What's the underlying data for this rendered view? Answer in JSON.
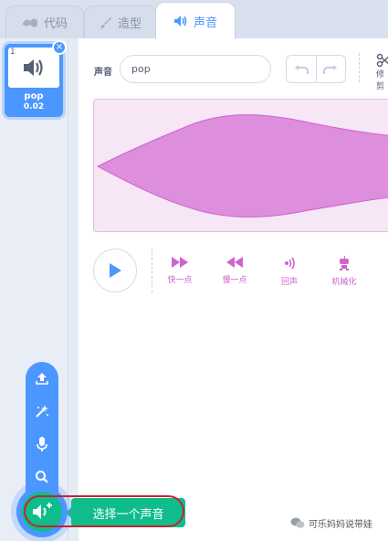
{
  "tabs": [
    {
      "label": "代码",
      "icon": "code-icon"
    },
    {
      "label": "造型",
      "icon": "brush-icon"
    },
    {
      "label": "声音",
      "icon": "speaker-icon",
      "active": true
    }
  ],
  "sound_list": {
    "items": [
      {
        "index": "1",
        "name": "pop",
        "duration": "0.02",
        "selected": true
      }
    ]
  },
  "editor": {
    "sound_label": "声音",
    "sound_name": "pop",
    "trim_label": "修剪",
    "effects": [
      {
        "label": "快一点",
        "icon": "faster-icon"
      },
      {
        "label": "慢一点",
        "icon": "slower-icon"
      },
      {
        "label": "回声",
        "icon": "echo-icon"
      },
      {
        "label": "机械化",
        "icon": "robot-icon"
      }
    ]
  },
  "add_menu": {
    "tooltip": "选择一个声音",
    "items": [
      "upload-icon",
      "surprise-icon",
      "record-icon",
      "search-icon"
    ]
  },
  "watermark": "可乐妈妈说带娃",
  "colors": {
    "accent": "#4c97ff",
    "sound_wave": "#cf63cf",
    "add_button": "#0fbd8c",
    "highlight": "#c0262c"
  }
}
